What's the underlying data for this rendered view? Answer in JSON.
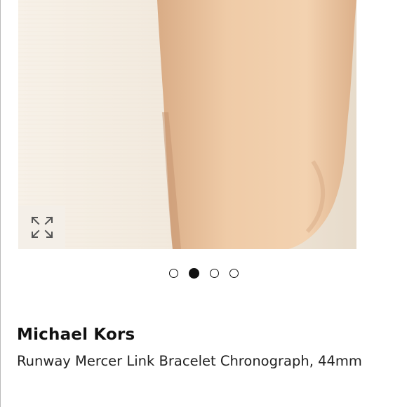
{
  "product": {
    "brand": "Michael Kors",
    "name": "Runway Mercer Link Bracelet Chronograph, 44mm"
  },
  "gallery": {
    "slide_count": 4,
    "active_slide": 2,
    "expand_icon": "expand-arrows-icon"
  },
  "colors": {
    "text": "#111111",
    "dot": "#111111",
    "image_background": "#f6f0e6"
  }
}
